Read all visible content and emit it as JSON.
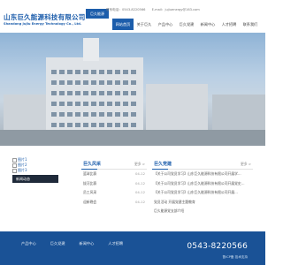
{
  "header": {
    "company_name": "山东巨久能源科技有限公司",
    "company_name_en": "Shandong Jujiu Energy Technology Co., Ltd.",
    "mark_label": "巨久能源",
    "phone_label": "联系电话：0543-8220566",
    "email_label": "E-mail：jujiuenergy@163.com"
  },
  "nav": {
    "items": [
      {
        "label": "网站首页",
        "active": true
      },
      {
        "label": "关于巨久"
      },
      {
        "label": "产品中心"
      },
      {
        "label": "巨久党建"
      },
      {
        "label": "新闻中心"
      },
      {
        "label": "人才招聘"
      },
      {
        "label": "联系我们"
      }
    ]
  },
  "sidebar": {
    "image_links": [
      "图片1",
      "图片2",
      "图片3"
    ],
    "active_label": "新闻动态"
  },
  "news_about": {
    "title": "巨久风采",
    "more": "更多 >",
    "rows": [
      {
        "text": "篮球比赛",
        "date": "04-12"
      },
      {
        "text": "拔河比赛",
        "date": "04-12"
      },
      {
        "text": "员工风采",
        "date": "04-12"
      },
      {
        "text": "迎新晚会",
        "date": "04-12"
      }
    ]
  },
  "news_party": {
    "title": "巨久党建",
    "more": "更多 >",
    "rows": [
      {
        "text": "【关于公司党员学习】山东巨久能源科技有限公司开展学…",
        "date": ""
      },
      {
        "text": "【关于公司党员学习】山东巨久能源科技有限公司开展党史…",
        "date": ""
      },
      {
        "text": "【关于公司党员学习】山东巨久能源科技有限公司开展…",
        "date": ""
      },
      {
        "text": "党员活动 开展党建主题教育",
        "date": ""
      },
      {
        "text": "巨久能源党支部介绍",
        "date": ""
      }
    ]
  },
  "footer": {
    "links": [
      "产品中心",
      "巨久党建",
      "新闻中心",
      "人才招聘"
    ],
    "phone": "0543-8220566",
    "icp": "鲁ICP备 技术支持"
  },
  "colors": {
    "brand_blue": "#1c5dab",
    "footer_blue": "#1a5296",
    "sidebar_dark": "#1f2a3a"
  }
}
